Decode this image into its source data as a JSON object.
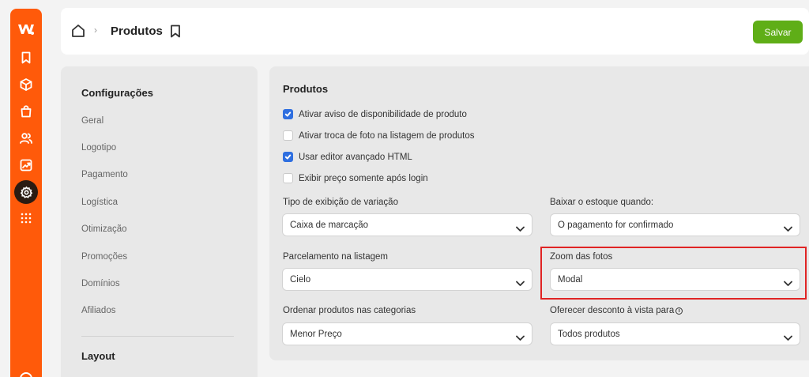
{
  "header": {
    "page_title": "Produtos",
    "save_label": "Salvar"
  },
  "rail": {
    "icons": [
      "logo-icon",
      "bookmark-icon",
      "box-icon",
      "bag-icon",
      "users-icon",
      "chart-icon",
      "gear-icon",
      "apps-grid-icon"
    ],
    "active": "gear-icon"
  },
  "settings": {
    "heading": "Configurações",
    "items": [
      "Geral",
      "Logotipo",
      "Pagamento",
      "Logística",
      "Otimização",
      "Promoções",
      "Domínios",
      "Afiliados"
    ],
    "section2_heading": "Layout"
  },
  "panel": {
    "title": "Produtos",
    "checkboxes": [
      {
        "label": "Ativar aviso de disponibilidade de produto",
        "checked": true
      },
      {
        "label": "Ativar troca de foto na listagem de produtos",
        "checked": false
      },
      {
        "label": "Usar editor avançado HTML",
        "checked": true
      },
      {
        "label": "Exibir preço somente após login",
        "checked": false
      }
    ],
    "fields": {
      "variation_display": {
        "label": "Tipo de exibição de variação",
        "value": "Caixa de marcação"
      },
      "stock_decrease": {
        "label": "Baixar o estoque quando:",
        "value": "O pagamento for confirmado"
      },
      "listing_installments": {
        "label": "Parcelamento na listagem",
        "value": "Cielo"
      },
      "photo_zoom": {
        "label": "Zoom das fotos",
        "value": "Modal"
      },
      "category_sort": {
        "label": "Ordenar produtos nas categorias",
        "value": "Menor Preço"
      },
      "cash_discount": {
        "label": "Oferecer desconto à vista para",
        "value": "Todos produtos"
      }
    }
  },
  "colors": {
    "rail": "#ff5a0a",
    "save_button": "#5fae17",
    "checkbox_checked": "#2f6fe0",
    "highlight": "#e02424"
  }
}
